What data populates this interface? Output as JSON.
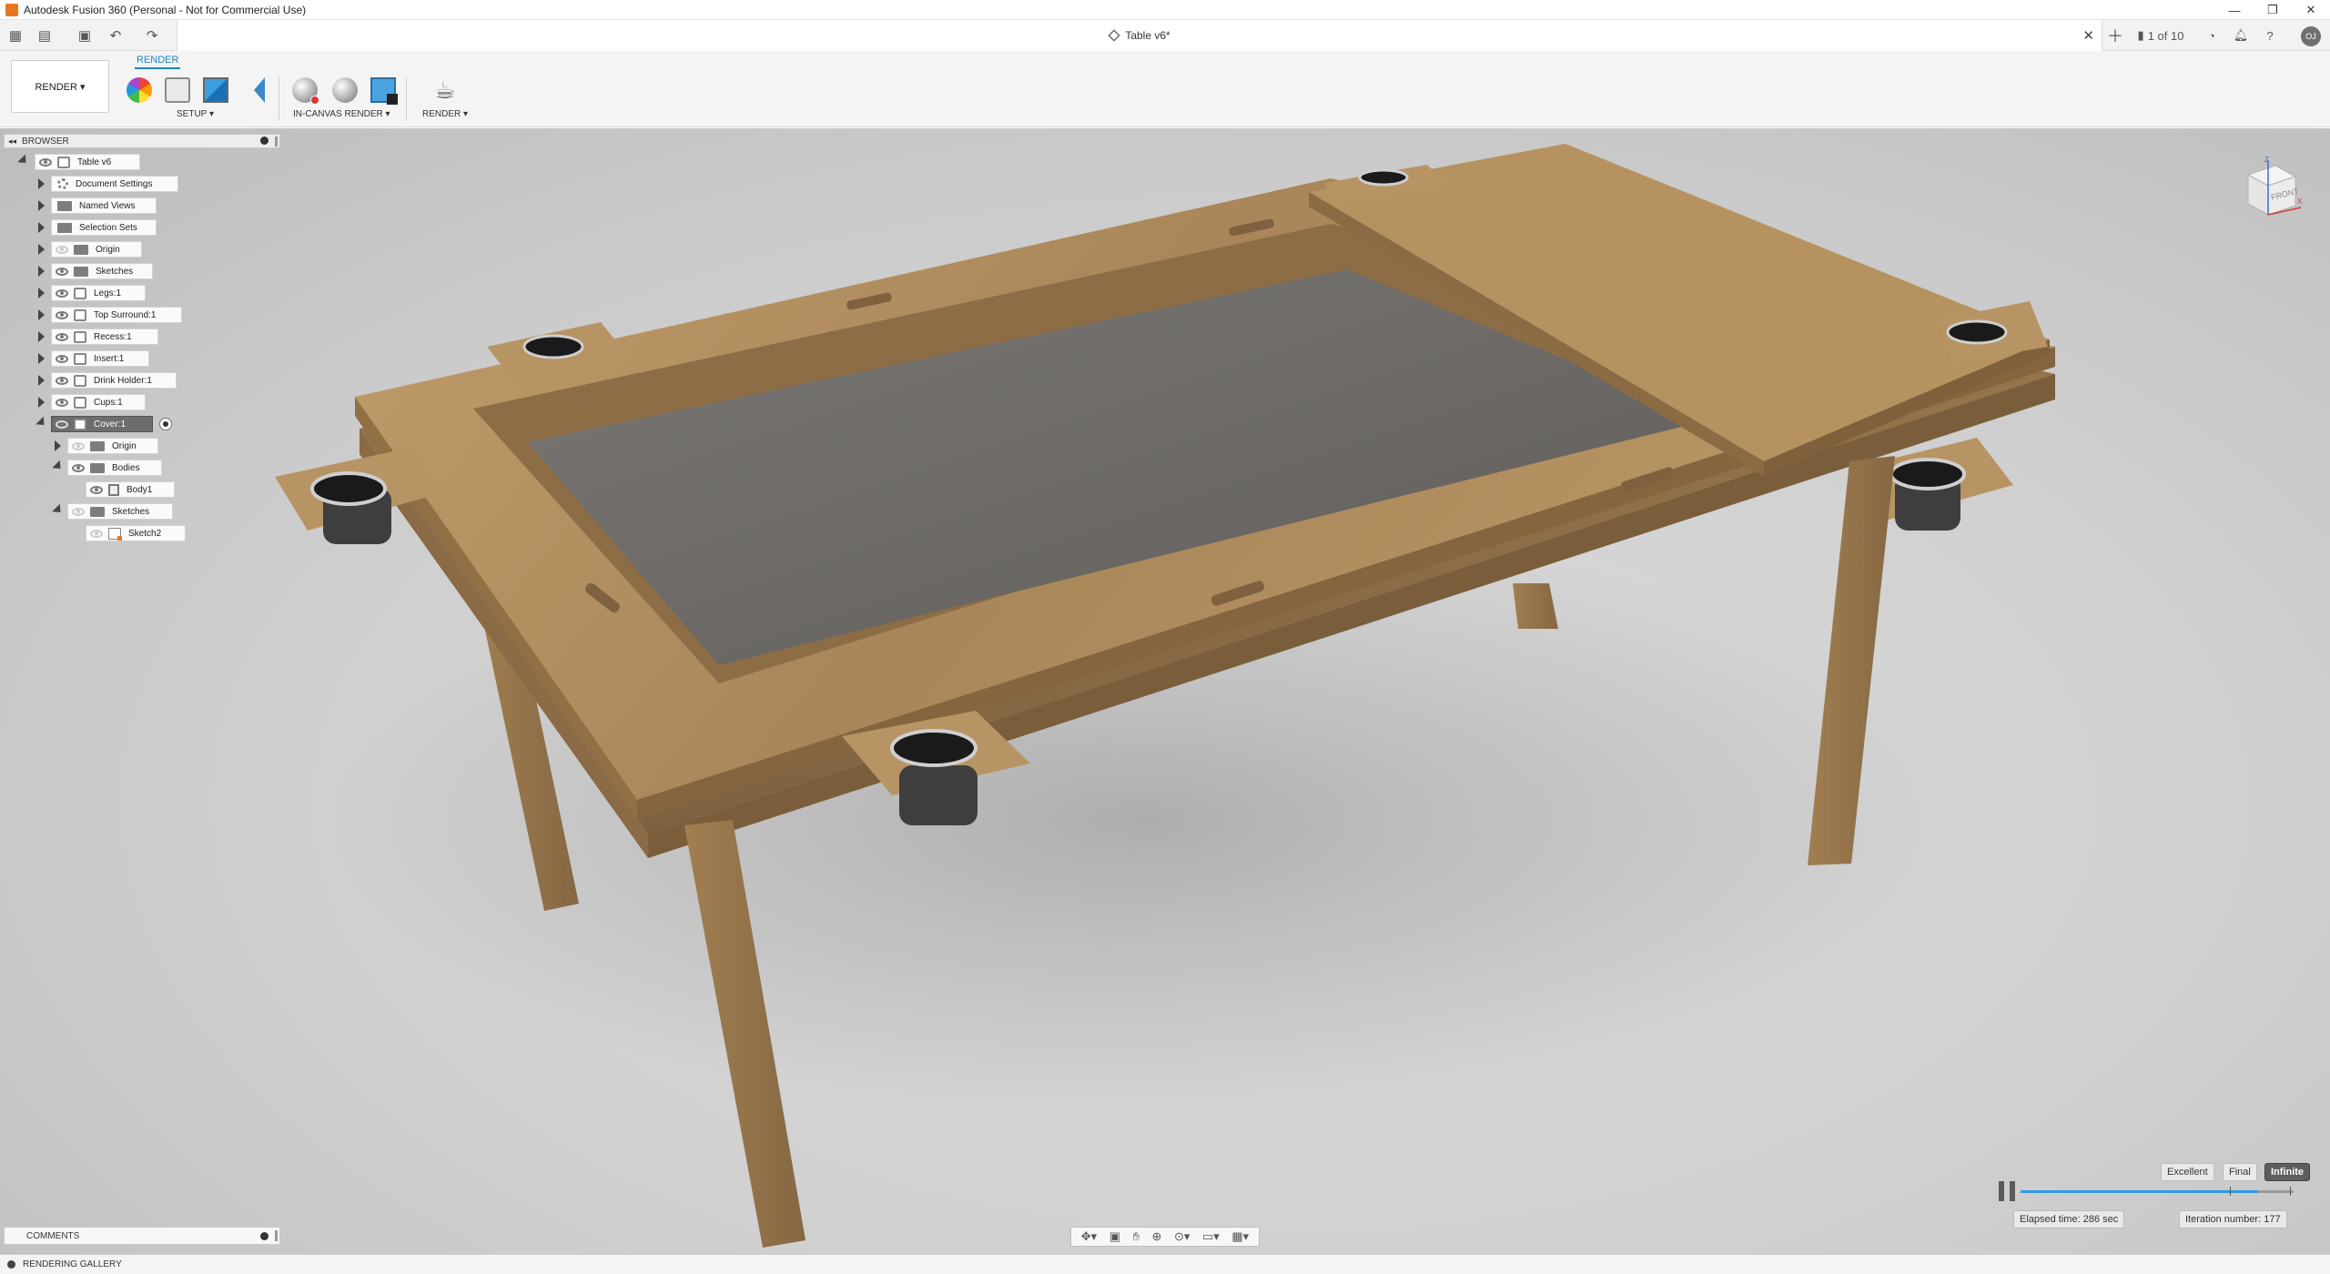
{
  "window": {
    "title": "Autodesk Fusion 360 (Personal - Not for Commercial Use)",
    "controls": [
      "—",
      "❐",
      "✕"
    ]
  },
  "document": {
    "tab_title": "Table v6*",
    "version_counter": "1 of 10",
    "user_initials": "OJ"
  },
  "toolbar": {
    "workspace": "RENDER ▾",
    "active_tab": "RENDER",
    "groups": {
      "setup": "SETUP ▾",
      "in_canvas": "IN-CANVAS RENDER ▾",
      "render": "RENDER ▾"
    }
  },
  "browser": {
    "header": "BROWSER",
    "root": "Table v6",
    "items": [
      {
        "label": "Document Settings"
      },
      {
        "label": "Named Views"
      },
      {
        "label": "Selection Sets"
      },
      {
        "label": "Origin"
      },
      {
        "label": "Sketches"
      },
      {
        "label": "Legs:1"
      },
      {
        "label": "Top Surround:1"
      },
      {
        "label": "Recess:1"
      },
      {
        "label": "Insert:1"
      },
      {
        "label": "Drink Holder:1"
      },
      {
        "label": "Cups:1"
      },
      {
        "label": "Cover:1"
      },
      {
        "label": "Origin"
      },
      {
        "label": "Bodies"
      },
      {
        "label": "Body1"
      },
      {
        "label": "Sketches"
      },
      {
        "label": "Sketch2"
      }
    ]
  },
  "viewcube": {
    "face": "FRONT",
    "axis_z": "Z",
    "axis_x": "X",
    "axis_y": "Y"
  },
  "comments": {
    "label": "COMMENTS"
  },
  "render_progress": {
    "quality": [
      "Excellent",
      "Final",
      "Infinite"
    ],
    "active_quality": "Infinite",
    "progress_fraction": 0.87,
    "elapsed": "Elapsed time: 286 sec",
    "iteration": "Iteration number: 177"
  },
  "bottom": {
    "gallery_label": "RENDERING GALLERY"
  },
  "colors": {
    "accent": "#1a84c7",
    "wood": "#b08d5f",
    "felt": "#6f6c69",
    "progress": "#2a9ce0"
  }
}
